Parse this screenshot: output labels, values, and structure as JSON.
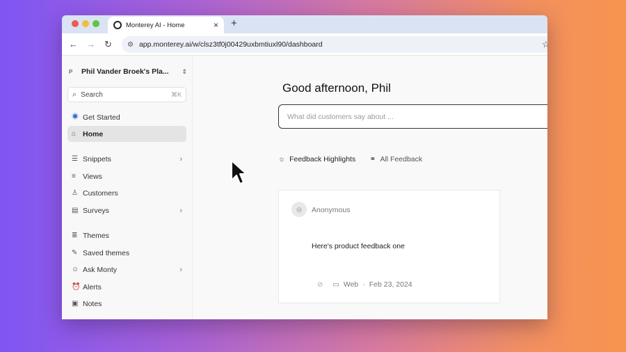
{
  "browser": {
    "tab_title": "Monterey AI - Home",
    "tab_close": "×",
    "new_tab": "+",
    "url": "app.monterey.ai/w/clsz3tf0j00429uxbmtiuxl90/dashboard",
    "back": "←",
    "forward": "→",
    "reload": "↻",
    "star": "☆"
  },
  "sidebar": {
    "workspace_avatar": "P",
    "workspace_name": "Phil Vander Broek's Pla...",
    "search_placeholder": "Search",
    "search_shortcut": "⌘K",
    "items": [
      {
        "label": "Get Started",
        "icon": "get-started-icon"
      },
      {
        "label": "Home",
        "icon": "home-icon",
        "active": true
      },
      {
        "label": "Snippets",
        "icon": "snippets-icon",
        "chevron": "›"
      },
      {
        "label": "Views",
        "icon": "views-icon"
      },
      {
        "label": "Customers",
        "icon": "customers-icon"
      },
      {
        "label": "Surveys",
        "icon": "surveys-icon",
        "chevron": "›"
      },
      {
        "label": "Themes",
        "icon": "themes-icon"
      },
      {
        "label": "Saved themes",
        "icon": "pin-icon"
      },
      {
        "label": "Ask Monty",
        "icon": "ask-monty-icon",
        "chevron": "›"
      },
      {
        "label": "Alerts",
        "icon": "alarm-icon"
      },
      {
        "label": "Notes",
        "icon": "notes-icon"
      }
    ]
  },
  "main": {
    "greeting": "Good afternoon, Phil",
    "ask_placeholder": "What did customers say about ...",
    "tabs": [
      {
        "label": "Feedback Highlights",
        "icon": "sun-icon"
      },
      {
        "label": "All Feedback",
        "icon": "link-icon"
      }
    ],
    "card": {
      "author": "Anonymous",
      "text": "Here's product feedback one",
      "source": "Web",
      "separator": "·",
      "date": "Feb 23, 2024"
    }
  }
}
